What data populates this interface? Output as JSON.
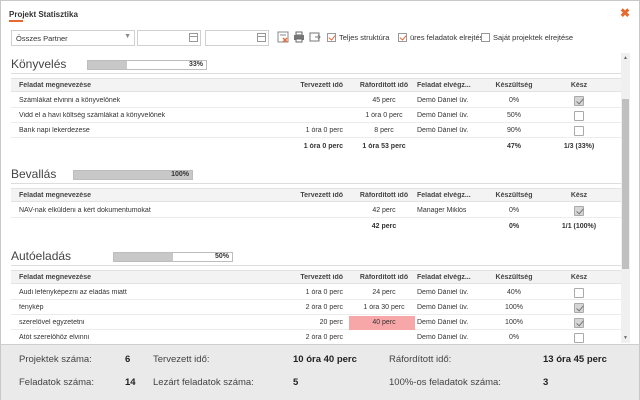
{
  "window": {
    "title": "Projekt Statisztika"
  },
  "toolbar": {
    "partner_select": "Összes Partner",
    "date_from": "",
    "date_to": "",
    "checkboxes": [
      {
        "label": "Teljes struktúra",
        "checked": true
      },
      {
        "label": "üres feladatok elrejtése",
        "checked": true
      },
      {
        "label": "Saját projektek elrejtése",
        "checked": false
      }
    ]
  },
  "columns": {
    "name": "Feladat megnevezése",
    "plan": "Tervezett idő",
    "spent": "Ráfordított idő",
    "owner": "Feladat elvégz...",
    "ready": "Készültség",
    "done": "Kész"
  },
  "sections": [
    {
      "title": "Könyvelés",
      "progress_pct": 33,
      "progress_label": "33%",
      "rows": [
        {
          "name": "Számlákat elvinni a könyvelőnek",
          "plan": "",
          "spent": "45 perc",
          "owner": "Demó Dániel üv.",
          "ready": "0%",
          "done": true,
          "highlight": false
        },
        {
          "name": "Vidd el a havi költség számlákat a könyvelőnek",
          "plan": "",
          "spent": "1 óra 0 perc",
          "owner": "Demó Dániel üv.",
          "ready": "50%",
          "done": false,
          "highlight": false
        },
        {
          "name": "Bank napi lekerdezese",
          "plan": "1 óra 0 perc",
          "spent": "8 perc",
          "owner": "Demó Dániel üv.",
          "ready": "90%",
          "done": false,
          "highlight": false
        }
      ],
      "total": {
        "plan": "1 óra 0 perc",
        "spent": "1 óra 53 perc",
        "ready": "47%",
        "done": "1/3 (33%)"
      }
    },
    {
      "title": "Bevallás",
      "progress_pct": 100,
      "progress_label": "100%",
      "rows": [
        {
          "name": "NAV-nak elküldeni a kért dokumentumokat",
          "plan": "",
          "spent": "42 perc",
          "owner": "Manager Miklós",
          "ready": "0%",
          "done": true,
          "highlight": false
        }
      ],
      "total": {
        "plan": "",
        "spent": "42 perc",
        "ready": "0%",
        "done": "1/1 (100%)"
      }
    },
    {
      "title": "Autóeladás",
      "progress_pct": 50,
      "progress_label": "50%",
      "rows": [
        {
          "name": "Audi lefényképezni az eladás miatt",
          "plan": "1 óra 0 perc",
          "spent": "24 perc",
          "owner": "Demó Dániel üv.",
          "ready": "40%",
          "done": false,
          "highlight": false
        },
        {
          "name": "fénykép",
          "plan": "2 óra 0 perc",
          "spent": "1 óra 30 perc",
          "owner": "Demó Dániel üv.",
          "ready": "100%",
          "done": true,
          "highlight": false
        },
        {
          "name": "szerelővel egyzetetni",
          "plan": "20 perc",
          "spent": "40 perc",
          "owner": "Demó Dániel üv.",
          "ready": "100%",
          "done": true,
          "highlight": true
        },
        {
          "name": "Atót szerelőhöz elvinni",
          "plan": "2 óra 0 perc",
          "spent": "",
          "owner": "Demó Dániel üv.",
          "ready": "0%",
          "done": false,
          "highlight": false
        }
      ]
    }
  ],
  "footer": {
    "projects_label": "Projektek száma:",
    "projects_value": "6",
    "planned_label": "Tervezett idő:",
    "planned_value": "10 óra 40 perc",
    "spent_label": "Ráfordított idő:",
    "spent_value": "13 óra 45 perc",
    "tasks_label": "Feladatok száma:",
    "tasks_value": "14",
    "closed_label": "Lezárt feladatok száma:",
    "closed_value": "5",
    "full_label": "100%-os feladatok száma:",
    "full_value": "3"
  },
  "colors": {
    "accent": "#e8692e",
    "highlight": "#f7a7a7"
  }
}
